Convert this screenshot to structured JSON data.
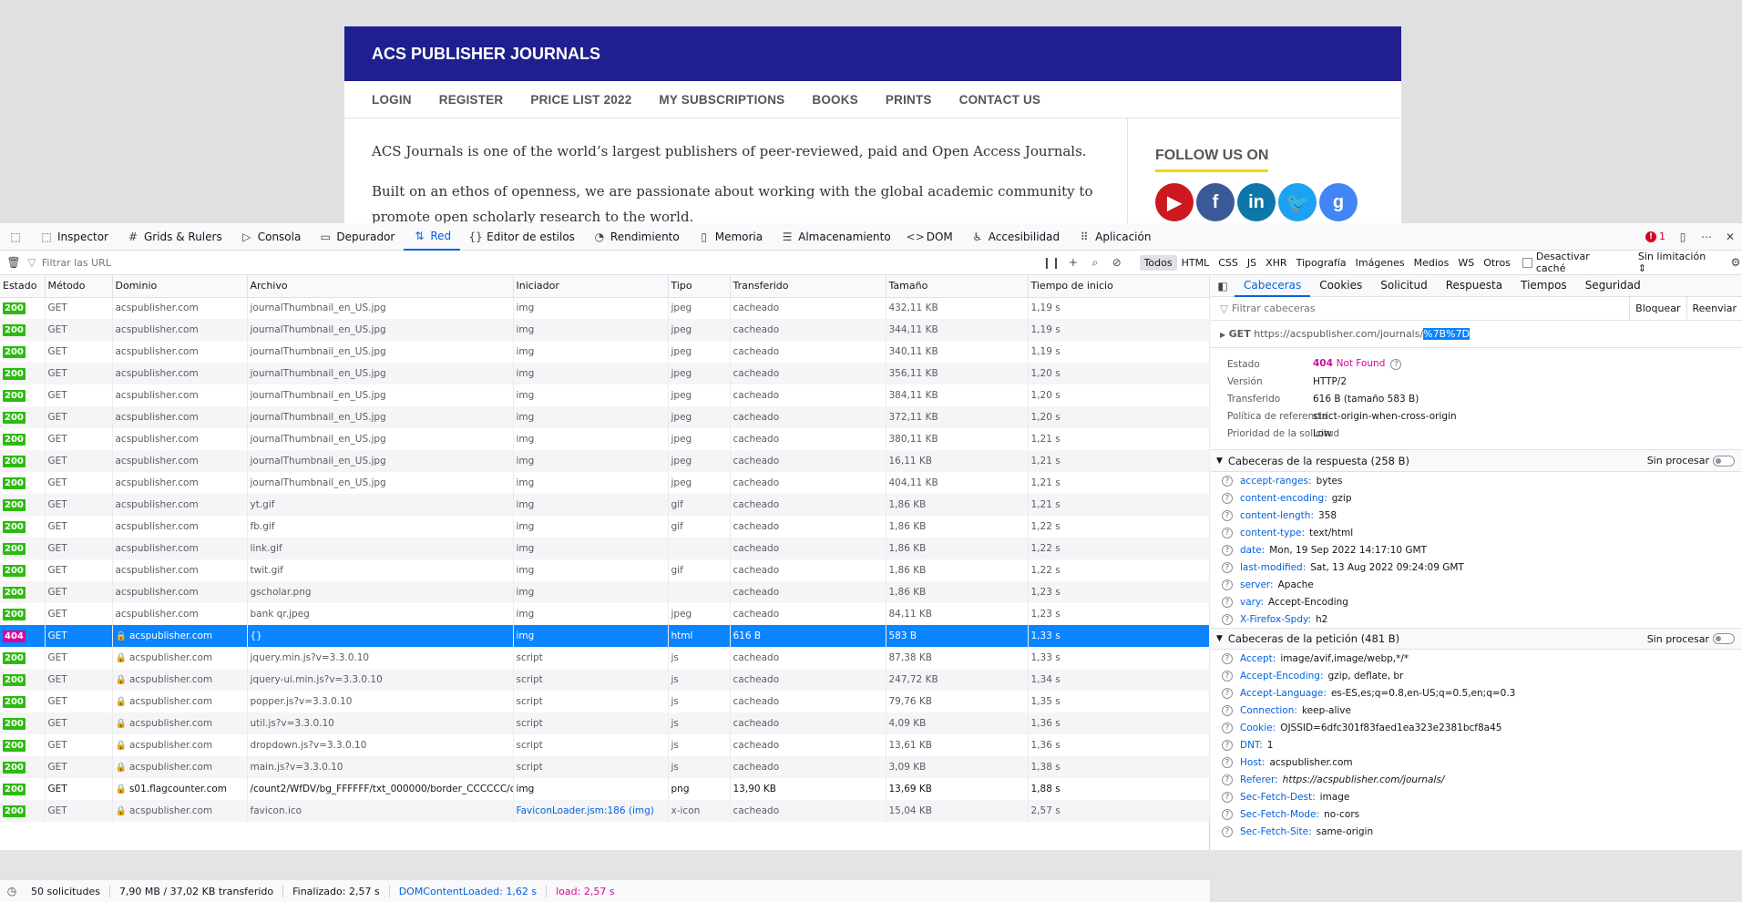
{
  "site": {
    "title": "ACS PUBLISHER JOURNALS",
    "nav": [
      "LOGIN",
      "REGISTER",
      "PRICE LIST 2022",
      "MY SUBSCRIPTIONS",
      "BOOKS",
      "PRINTS",
      "CONTACT US"
    ],
    "para1": "ACS Journals is one of the world’s largest publishers of peer-reviewed, paid and Open Access Journals.",
    "para2": "Built on an ethos of openness, we are passionate about working with the global academic community to promote open scholarly research to the world.",
    "follow_title": "FOLLOW US ON",
    "social": [
      {
        "name": "youtube-icon",
        "glyph": "▶",
        "color": "#cc181e"
      },
      {
        "name": "facebook-icon",
        "glyph": "f",
        "color": "#3b5998"
      },
      {
        "name": "linkedin-icon",
        "glyph": "in",
        "color": "#0e76a8"
      },
      {
        "name": "twitter-icon",
        "glyph": "🐦",
        "color": "#1da1f2"
      },
      {
        "name": "google-scholar-icon",
        "glyph": "g",
        "color": "#4285f4"
      }
    ]
  },
  "devtools": {
    "tabs": [
      {
        "label": "Inspector",
        "icon": "inspector-icon",
        "glyph": "⬚"
      },
      {
        "label": "Grids & Rulers",
        "icon": "grid-icon",
        "glyph": "#"
      },
      {
        "label": "Consola",
        "icon": "console-icon",
        "glyph": "▷"
      },
      {
        "label": "Depurador",
        "icon": "debugger-icon",
        "glyph": "▭"
      },
      {
        "label": "Red",
        "icon": "network-icon",
        "glyph": "⇅"
      },
      {
        "label": "Editor de estilos",
        "icon": "style-editor-icon",
        "glyph": "{}"
      },
      {
        "label": "Rendimiento",
        "icon": "performance-icon",
        "glyph": "◔"
      },
      {
        "label": "Memoria",
        "icon": "memory-icon",
        "glyph": "▯"
      },
      {
        "label": "Almacenamiento",
        "icon": "storage-icon",
        "glyph": "☰"
      },
      {
        "label": "DOM",
        "icon": "dom-icon",
        "glyph": "<>"
      },
      {
        "label": "Accesibilidad",
        "icon": "accessibility-icon",
        "glyph": "♿"
      },
      {
        "label": "Aplicación",
        "icon": "application-icon",
        "glyph": "⠿"
      }
    ],
    "active_tab": "Red",
    "error_count": "1",
    "filter_placeholder": "Filtrar las URL",
    "type_filters": [
      "Todos",
      "HTML",
      "CSS",
      "JS",
      "XHR",
      "Tipografía",
      "Imágenes",
      "Medios",
      "WS",
      "Otros"
    ],
    "disable_cache_label": "Desactivar caché",
    "throttle_label": "Sin limitación ⇕",
    "columns": [
      "Estado",
      "Método",
      "Dominio",
      "Archivo",
      "Iniciador",
      "Tipo",
      "Transferido",
      "Tamaño",
      "Tiempo de inicio"
    ],
    "requests": [
      {
        "status": "200",
        "method": "GET",
        "domain": "acspublisher.com",
        "lock": false,
        "file": "journalThumbnail_en_US.jpg",
        "initiator": "img",
        "type": "jpeg",
        "transferred": "cacheado",
        "size": "432,11 KB",
        "start": "1,19 s"
      },
      {
        "status": "200",
        "method": "GET",
        "domain": "acspublisher.com",
        "lock": false,
        "file": "journalThumbnail_en_US.jpg",
        "initiator": "img",
        "type": "jpeg",
        "transferred": "cacheado",
        "size": "344,11 KB",
        "start": "1,19 s"
      },
      {
        "status": "200",
        "method": "GET",
        "domain": "acspublisher.com",
        "lock": false,
        "file": "journalThumbnail_en_US.jpg",
        "initiator": "img",
        "type": "jpeg",
        "transferred": "cacheado",
        "size": "340,11 KB",
        "start": "1,19 s"
      },
      {
        "status": "200",
        "method": "GET",
        "domain": "acspublisher.com",
        "lock": false,
        "file": "journalThumbnail_en_US.jpg",
        "initiator": "img",
        "type": "jpeg",
        "transferred": "cacheado",
        "size": "356,11 KB",
        "start": "1,20 s"
      },
      {
        "status": "200",
        "method": "GET",
        "domain": "acspublisher.com",
        "lock": false,
        "file": "journalThumbnail_en_US.jpg",
        "initiator": "img",
        "type": "jpeg",
        "transferred": "cacheado",
        "size": "384,11 KB",
        "start": "1,20 s"
      },
      {
        "status": "200",
        "method": "GET",
        "domain": "acspublisher.com",
        "lock": false,
        "file": "journalThumbnail_en_US.jpg",
        "initiator": "img",
        "type": "jpeg",
        "transferred": "cacheado",
        "size": "372,11 KB",
        "start": "1,20 s"
      },
      {
        "status": "200",
        "method": "GET",
        "domain": "acspublisher.com",
        "lock": false,
        "file": "journalThumbnail_en_US.jpg",
        "initiator": "img",
        "type": "jpeg",
        "transferred": "cacheado",
        "size": "380,11 KB",
        "start": "1,21 s"
      },
      {
        "status": "200",
        "method": "GET",
        "domain": "acspublisher.com",
        "lock": false,
        "file": "journalThumbnail_en_US.jpg",
        "initiator": "img",
        "type": "jpeg",
        "transferred": "cacheado",
        "size": "16,11 KB",
        "start": "1,21 s"
      },
      {
        "status": "200",
        "method": "GET",
        "domain": "acspublisher.com",
        "lock": false,
        "file": "journalThumbnail_en_US.jpg",
        "initiator": "img",
        "type": "jpeg",
        "transferred": "cacheado",
        "size": "404,11 KB",
        "start": "1,21 s"
      },
      {
        "status": "200",
        "method": "GET",
        "domain": "acspublisher.com",
        "lock": false,
        "file": "yt.gif",
        "initiator": "img",
        "type": "gif",
        "transferred": "cacheado",
        "size": "1,86 KB",
        "start": "1,21 s"
      },
      {
        "status": "200",
        "method": "GET",
        "domain": "acspublisher.com",
        "lock": false,
        "file": "fb.gif",
        "initiator": "img",
        "type": "gif",
        "transferred": "cacheado",
        "size": "1,86 KB",
        "start": "1,22 s"
      },
      {
        "status": "200",
        "method": "GET",
        "domain": "acspublisher.com",
        "lock": false,
        "file": "link.gif",
        "initiator": "img",
        "type": "",
        "transferred": "cacheado",
        "size": "1,86 KB",
        "start": "1,22 s"
      },
      {
        "status": "200",
        "method": "GET",
        "domain": "acspublisher.com",
        "lock": false,
        "file": "twit.gif",
        "initiator": "img",
        "type": "gif",
        "transferred": "cacheado",
        "size": "1,86 KB",
        "start": "1,22 s"
      },
      {
        "status": "200",
        "method": "GET",
        "domain": "acspublisher.com",
        "lock": false,
        "file": "gscholar.png",
        "initiator": "img",
        "type": "",
        "transferred": "cacheado",
        "size": "1,86 KB",
        "start": "1,23 s"
      },
      {
        "status": "200",
        "method": "GET",
        "domain": "acspublisher.com",
        "lock": false,
        "file": "bank qr.jpeg",
        "initiator": "img",
        "type": "jpeg",
        "transferred": "cacheado",
        "size": "84,11 KB",
        "start": "1,23 s"
      },
      {
        "status": "404",
        "method": "GET",
        "domain": "acspublisher.com",
        "lock": true,
        "file": "{}",
        "initiator": "img",
        "type": "html",
        "transferred": "616 B",
        "size": "583 B",
        "start": "1,33 s",
        "selected": true
      },
      {
        "status": "200",
        "method": "GET",
        "domain": "acspublisher.com",
        "lock": true,
        "file": "jquery.min.js?v=3.3.0.10",
        "initiator": "script",
        "type": "js",
        "transferred": "cacheado",
        "size": "87,38 KB",
        "start": "1,33 s"
      },
      {
        "status": "200",
        "method": "GET",
        "domain": "acspublisher.com",
        "lock": true,
        "file": "jquery-ui.min.js?v=3.3.0.10",
        "initiator": "script",
        "type": "js",
        "transferred": "cacheado",
        "size": "247,72 KB",
        "start": "1,34 s"
      },
      {
        "status": "200",
        "method": "GET",
        "domain": "acspublisher.com",
        "lock": true,
        "file": "popper.js?v=3.3.0.10",
        "initiator": "script",
        "type": "js",
        "transferred": "cacheado",
        "size": "79,76 KB",
        "start": "1,35 s"
      },
      {
        "status": "200",
        "method": "GET",
        "domain": "acspublisher.com",
        "lock": true,
        "file": "util.js?v=3.3.0.10",
        "initiator": "script",
        "type": "js",
        "transferred": "cacheado",
        "size": "4,09 KB",
        "start": "1,36 s"
      },
      {
        "status": "200",
        "method": "GET",
        "domain": "acspublisher.com",
        "lock": true,
        "file": "dropdown.js?v=3.3.0.10",
        "initiator": "script",
        "type": "js",
        "transferred": "cacheado",
        "size": "13,61 KB",
        "start": "1,36 s"
      },
      {
        "status": "200",
        "method": "GET",
        "domain": "acspublisher.com",
        "lock": true,
        "file": "main.js?v=3.3.0.10",
        "initiator": "script",
        "type": "js",
        "transferred": "cacheado",
        "size": "3,09 KB",
        "start": "1,38 s"
      },
      {
        "status": "200",
        "method": "GET",
        "domain": "s01.flagcounter.com",
        "lock": true,
        "file": "/count2/WfDV/bg_FFFFFF/txt_000000/border_CCCCCC/c",
        "initiator": "img",
        "type": "png",
        "transferred": "13,90 KB",
        "size": "13,69 KB",
        "start": "1,88 s",
        "strong": true
      },
      {
        "status": "200",
        "method": "GET",
        "domain": "acspublisher.com",
        "lock": true,
        "file": "favicon.ico",
        "initiator": "FaviconLoader.jsm:186 (img)",
        "initiator_link": true,
        "type": "x-icon",
        "transferred": "cacheado",
        "size": "15,04 KB",
        "start": "2,57 s"
      }
    ],
    "statusbar": {
      "requests": "50 solicitudes",
      "transferred": "7,90 MB / 37,02 KB transferido",
      "finished": "Finalizado: 2,57 s",
      "dcl": "DOMContentLoaded: 1,62 s",
      "load": "load: 2,57 s"
    },
    "details": {
      "tabs": [
        "Cabeceras",
        "Cookies",
        "Solicitud",
        "Respuesta",
        "Tiempos",
        "Seguridad"
      ],
      "filter_placeholder": "Filtrar cabeceras",
      "block_label": "Bloquear",
      "resend_label": "Reenviar",
      "url_method": "GET",
      "url_base": "https://acspublisher.com/journals/",
      "url_highlight": "%7B%7D",
      "summary": [
        {
          "k": "Estado",
          "v": "404 Not Found"
        },
        {
          "k": "Versión",
          "v": "HTTP/2"
        },
        {
          "k": "Transferido",
          "v": "616 B (tamaño 583 B)"
        },
        {
          "k": "Política de referencia",
          "v": "strict-origin-when-cross-origin"
        },
        {
          "k": "Prioridad de la solicitud",
          "v": "Low"
        }
      ],
      "raw_label": "Sin procesar",
      "resp_title": "Cabeceras de la respuesta (258 B)",
      "resp_headers": [
        {
          "k": "accept-ranges:",
          "v": "bytes"
        },
        {
          "k": "content-encoding:",
          "v": "gzip"
        },
        {
          "k": "content-length:",
          "v": "358"
        },
        {
          "k": "content-type:",
          "v": "text/html"
        },
        {
          "k": "date:",
          "v": "Mon, 19 Sep 2022 14:17:10 GMT"
        },
        {
          "k": "last-modified:",
          "v": "Sat, 13 Aug 2022 09:24:09 GMT"
        },
        {
          "k": "server:",
          "v": "Apache"
        },
        {
          "k": "vary:",
          "v": "Accept-Encoding"
        },
        {
          "k": "X-Firefox-Spdy:",
          "v": "h2"
        }
      ],
      "req_title": "Cabeceras de la petición (481 B)",
      "req_headers": [
        {
          "k": "Accept:",
          "v": "image/avif,image/webp,*/*"
        },
        {
          "k": "Accept-Encoding:",
          "v": "gzip, deflate, br"
        },
        {
          "k": "Accept-Language:",
          "v": "es-ES,es;q=0.8,en-US;q=0.5,en;q=0.3"
        },
        {
          "k": "Connection:",
          "v": "keep-alive"
        },
        {
          "k": "Cookie:",
          "v": "OJSSID=6dfc301f83faed1ea323e2381bcf8a45"
        },
        {
          "k": "DNT:",
          "v": "1"
        },
        {
          "k": "Host:",
          "v": "acspublisher.com"
        },
        {
          "k": "Referer:",
          "v": "https://acspublisher.com/journals/",
          "italic": true
        },
        {
          "k": "Sec-Fetch-Dest:",
          "v": "image"
        },
        {
          "k": "Sec-Fetch-Mode:",
          "v": "no-cors"
        },
        {
          "k": "Sec-Fetch-Site:",
          "v": "same-origin"
        }
      ]
    }
  }
}
